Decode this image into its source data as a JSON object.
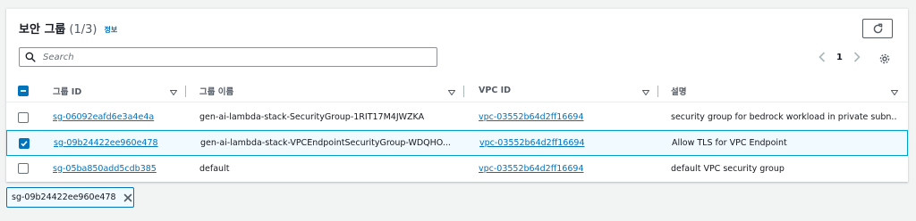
{
  "header": {
    "title": "보안 그룹",
    "count": "(1/3)",
    "info_label": "정보"
  },
  "search": {
    "placeholder": "Search",
    "value": ""
  },
  "pagination": {
    "current_page": "1"
  },
  "table": {
    "columns": [
      {
        "label": "그룹 ID"
      },
      {
        "label": "그룹 이름"
      },
      {
        "label": "VPC ID"
      },
      {
        "label": "설명"
      }
    ],
    "rows": [
      {
        "selected": false,
        "group_id": "sg-06092eafd6e3a4e4a",
        "group_name": "gen-ai-lambda-stack-SecurityGroup-1RIT17M4JWZKA",
        "vpc_id": "vpc-03552b64d2ff16694",
        "description": "security group for bedrock workload in private subn..."
      },
      {
        "selected": true,
        "group_id": "sg-09b24422ee960e478",
        "group_name": "gen-ai-lambda-stack-VPCEndpointSecurityGroup-WDQHO...",
        "vpc_id": "vpc-03552b64d2ff16694",
        "description": "Allow TLS for VPC Endpoint"
      },
      {
        "selected": false,
        "group_id": "sg-05ba850add5cdb385",
        "group_name": "default",
        "vpc_id": "vpc-03552b64d2ff16694",
        "description": "default VPC security group"
      }
    ]
  },
  "selection_token": {
    "label": "sg-09b24422ee960e478"
  },
  "colors": {
    "link": "#0073bb",
    "selected_row_bg": "#f1faff",
    "selected_row_border": "#00a1c9",
    "checkbox_checked": "#0073bb"
  },
  "icons": {
    "refresh": "refresh-icon",
    "search": "search-icon",
    "settings": "gear-icon",
    "prev": "chevron-left-icon",
    "next": "chevron-right-icon",
    "sort": "caret-down-icon",
    "remove": "close-icon"
  }
}
